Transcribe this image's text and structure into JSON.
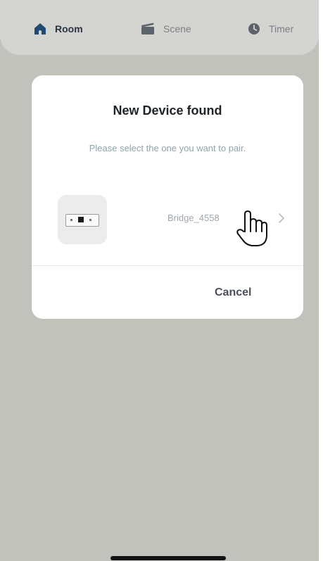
{
  "tabs": {
    "room": {
      "label": "Room",
      "icon": "home-icon",
      "active": true
    },
    "scene": {
      "label": "Scene",
      "icon": "scene-icon",
      "active": false
    },
    "timer": {
      "label": "Timer",
      "icon": "clock-icon",
      "active": false
    }
  },
  "dialog": {
    "title": "New Device found",
    "subtitle": "Please select the one you want to pair.",
    "device": {
      "name": "Bridge_4558",
      "icon": "bridge-device-icon",
      "chevron": "chevron-right-icon"
    },
    "cancel_label": "Cancel"
  },
  "pointer": "hand-pointer-icon",
  "colors": {
    "background_overlay": "#c2c2bd",
    "topbar": "#d4d4d0",
    "active_tab": "#2a3540",
    "inactive_tab": "#7a8088",
    "subtitle": "#8fa3ad"
  }
}
